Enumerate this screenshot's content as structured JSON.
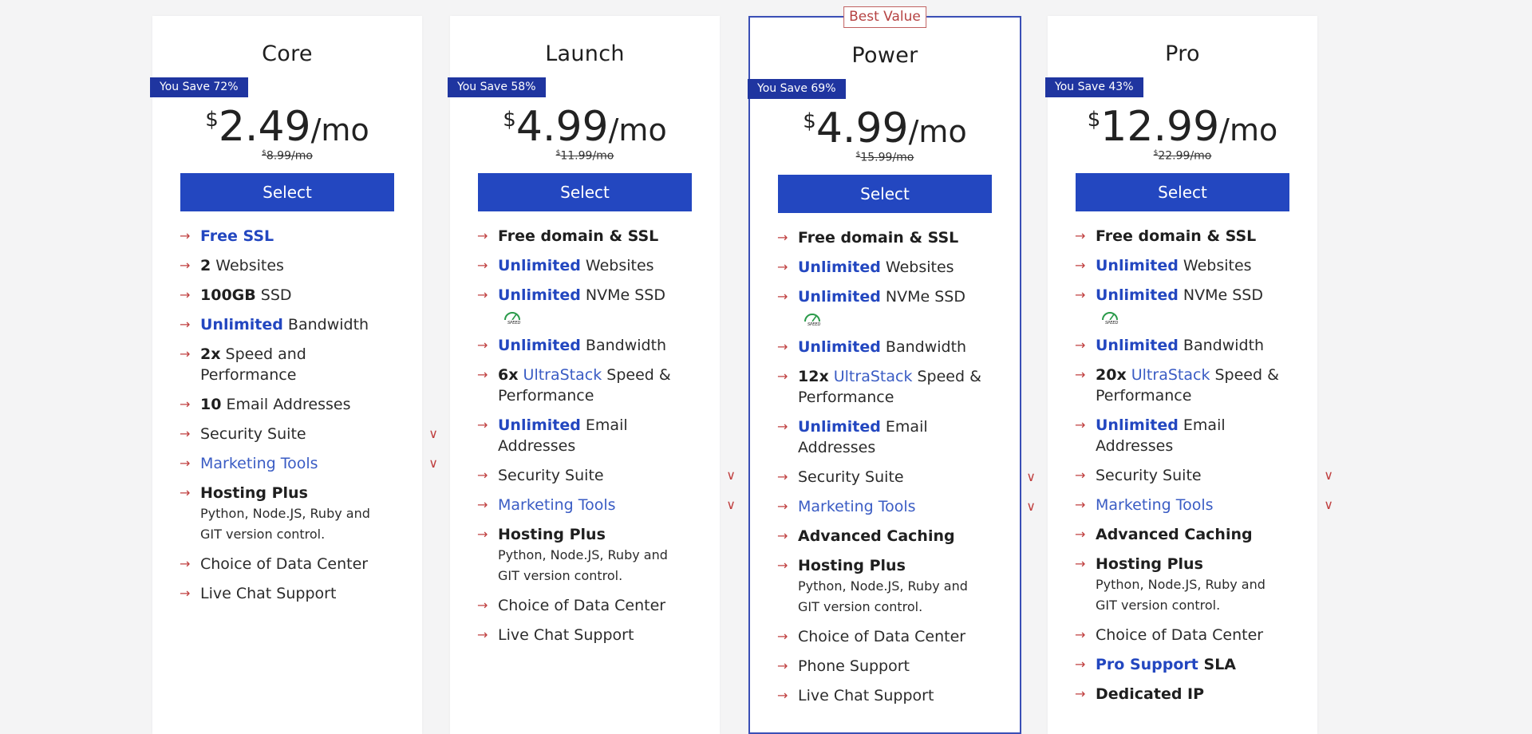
{
  "colors": {
    "accent": "#2347c0",
    "save_tag": "#1f35a0",
    "arrow": "#c04040",
    "best_value": "#b54242"
  },
  "best_value_label": "Best Value",
  "plans": [
    {
      "name": "Core",
      "save": "You Save 72%",
      "currency": "$",
      "price": "2.49",
      "per": "/mo",
      "old_currency": "$",
      "old_price": "8.99/mo",
      "select": "Select",
      "features": [
        {
          "kind": "blue",
          "bold": "Free SSL",
          "rest": ""
        },
        {
          "kind": "bold",
          "bold": "2",
          "rest": " Websites"
        },
        {
          "kind": "bold",
          "bold": "100GB",
          "rest": " SSD"
        },
        {
          "kind": "blue",
          "bold": "Unlimited",
          "rest": " Bandwidth"
        },
        {
          "kind": "bold",
          "bold": "2x",
          "rest": " Speed and Performance"
        },
        {
          "kind": "bold",
          "bold": "10",
          "rest": " Email Addresses"
        },
        {
          "kind": "dropdown",
          "text": "Security Suite"
        },
        {
          "kind": "dropdown-blue",
          "text": "Marketing Tools"
        },
        {
          "kind": "hosting",
          "bold": "Hosting Plus",
          "sub": "Python,  Node.JS,  Ruby and GIT version control."
        },
        {
          "kind": "plain",
          "text": "Choice of Data Center"
        },
        {
          "kind": "plain",
          "text": "Live Chat Support"
        }
      ]
    },
    {
      "name": "Launch",
      "save": "You Save 58%",
      "currency": "$",
      "price": "4.99",
      "per": "/mo",
      "old_currency": "$",
      "old_price": "11.99/mo",
      "select": "Select",
      "features": [
        {
          "kind": "bold",
          "bold": "Free domain & SSL",
          "rest": ""
        },
        {
          "kind": "blue",
          "bold": "Unlimited",
          "rest": " Websites"
        },
        {
          "kind": "blue-speed",
          "bold": "Unlimited",
          "rest": " NVMe SSD"
        },
        {
          "kind": "blue",
          "bold": "Unlimited",
          "rest": " Bandwidth"
        },
        {
          "kind": "ultra",
          "bold": "6x",
          "link": "UltraStack",
          "rest": " Speed & Performance"
        },
        {
          "kind": "blue",
          "bold": "Unlimited",
          "rest": " Email Addresses"
        },
        {
          "kind": "dropdown",
          "text": "Security Suite"
        },
        {
          "kind": "dropdown-blue",
          "text": "Marketing Tools"
        },
        {
          "kind": "hosting",
          "bold": "Hosting Plus",
          "sub": "Python,  Node.JS,  Ruby and GIT version control."
        },
        {
          "kind": "plain",
          "text": "Choice of Data Center"
        },
        {
          "kind": "plain",
          "text": "Live Chat Support"
        }
      ]
    },
    {
      "name": "Power",
      "save": "You Save 69%",
      "currency": "$",
      "price": "4.99",
      "per": "/mo",
      "old_currency": "$",
      "old_price": "15.99/mo",
      "select": "Select",
      "features": [
        {
          "kind": "bold",
          "bold": "Free domain & SSL",
          "rest": ""
        },
        {
          "kind": "blue",
          "bold": "Unlimited",
          "rest": " Websites"
        },
        {
          "kind": "blue-speed",
          "bold": "Unlimited",
          "rest": " NVMe SSD"
        },
        {
          "kind": "blue",
          "bold": "Unlimited",
          "rest": " Bandwidth"
        },
        {
          "kind": "ultra",
          "bold": "12x",
          "link": "UltraStack",
          "rest": " Speed & Performance"
        },
        {
          "kind": "blue",
          "bold": "Unlimited",
          "rest": " Email Addresses"
        },
        {
          "kind": "dropdown",
          "text": "Security Suite"
        },
        {
          "kind": "dropdown-blue",
          "text": "Marketing Tools"
        },
        {
          "kind": "bold",
          "bold": "Advanced Caching",
          "rest": ""
        },
        {
          "kind": "hosting",
          "bold": "Hosting Plus",
          "sub": "Python,  Node.JS,  Ruby and GIT version control."
        },
        {
          "kind": "plain",
          "text": "Choice of Data Center"
        },
        {
          "kind": "plain",
          "text": "Phone Support"
        },
        {
          "kind": "plain",
          "text": "Live Chat Support"
        }
      ]
    },
    {
      "name": "Pro",
      "save": "You Save 43%",
      "currency": "$",
      "price": "12.99",
      "per": "/mo",
      "old_currency": "$",
      "old_price": "22.99/mo",
      "select": "Select",
      "features": [
        {
          "kind": "bold",
          "bold": "Free domain & SSL",
          "rest": ""
        },
        {
          "kind": "blue",
          "bold": "Unlimited",
          "rest": " Websites"
        },
        {
          "kind": "blue-speed",
          "bold": "Unlimited",
          "rest": " NVMe SSD"
        },
        {
          "kind": "blue",
          "bold": "Unlimited",
          "rest": " Bandwidth"
        },
        {
          "kind": "ultra",
          "bold": "20x",
          "link": "UltraStack",
          "rest": " Speed & Performance"
        },
        {
          "kind": "blue",
          "bold": "Unlimited",
          "rest": " Email Addresses"
        },
        {
          "kind": "dropdown",
          "text": "Security Suite"
        },
        {
          "kind": "dropdown-blue",
          "text": "Marketing Tools"
        },
        {
          "kind": "bold",
          "bold": "Advanced Caching",
          "rest": ""
        },
        {
          "kind": "hosting",
          "bold": "Hosting Plus",
          "sub": "Python,  Node.JS,  Ruby and GIT version control."
        },
        {
          "kind": "plain",
          "text": "Choice of Data Center"
        },
        {
          "kind": "pro",
          "blue": "Pro Support",
          "bold": " SLA"
        },
        {
          "kind": "bold",
          "bold": "Dedicated IP",
          "rest": ""
        }
      ]
    }
  ]
}
